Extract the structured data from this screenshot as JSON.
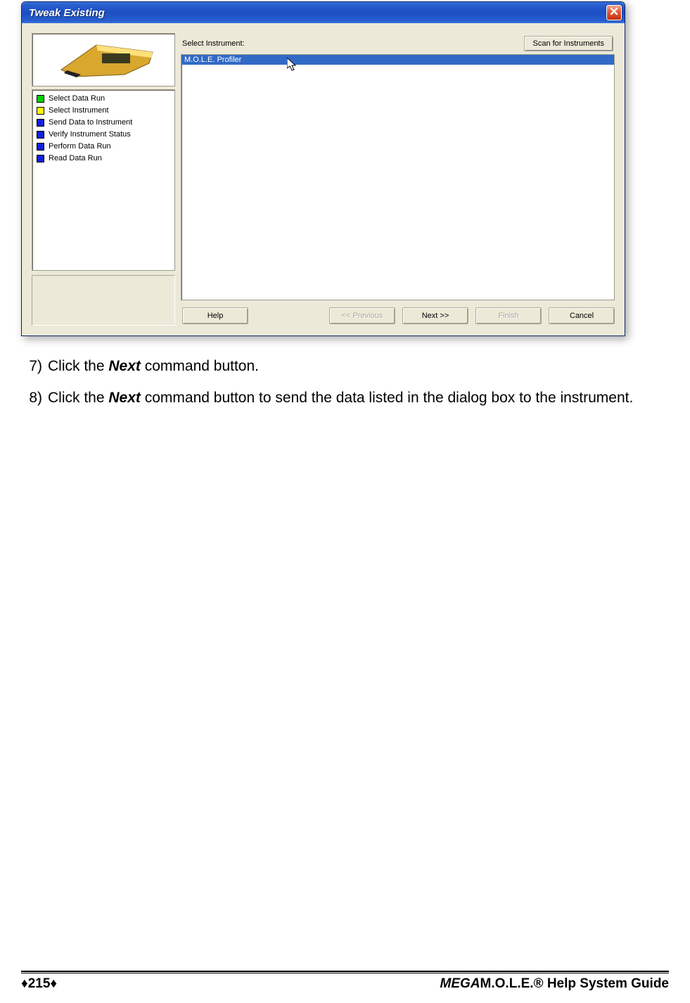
{
  "dialog": {
    "title": "Tweak Existing",
    "select_label": "Select Instrument:",
    "scan_button": "Scan for Instruments",
    "list_item": "M.O.L.E. Profiler",
    "steps": [
      {
        "color": "green",
        "label": "Select Data Run"
      },
      {
        "color": "yellow",
        "label": "Select Instrument"
      },
      {
        "color": "blue",
        "label": "Send Data to Instrument"
      },
      {
        "color": "blue",
        "label": "Verify Instrument Status"
      },
      {
        "color": "blue",
        "label": "Perform Data Run"
      },
      {
        "color": "blue",
        "label": "Read Data Run"
      }
    ],
    "buttons": {
      "help": "Help",
      "previous": "<< Previous",
      "next": "Next >>",
      "finish": "Finish",
      "cancel": "Cancel"
    }
  },
  "instructions": {
    "item7_num": "7)",
    "item7_a": "Click the ",
    "item7_bold": "Next",
    "item7_b": " command button.",
    "item8_num": "8)",
    "item8_a": "Click the ",
    "item8_bold": "Next",
    "item8_b": " command button to send the data listed in the dialog box to the instrument."
  },
  "footer": {
    "page_marker": "♦215♦",
    "guide_mega": "MEGA",
    "guide_rest": "M.O.L.E.® Help System Guide"
  }
}
